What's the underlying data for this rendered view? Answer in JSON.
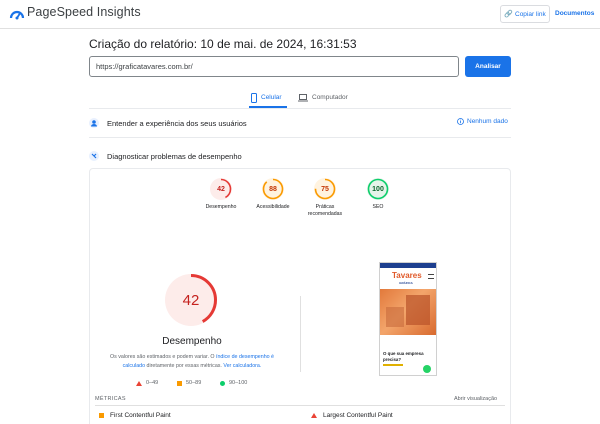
{
  "header": {
    "app_title": "PageSpeed Insights",
    "copy_link_label": "Copiar link",
    "docs_label": "Documentos"
  },
  "report": {
    "title": "Criação do relatório: 10 de mai. de 2024, 16:31:53",
    "url_value": "https://graficatavares.com.br/",
    "analyze_label": "Analisar"
  },
  "tabs": [
    {
      "label": "Celular",
      "selected": true
    },
    {
      "label": "Computador",
      "selected": false
    }
  ],
  "sections": {
    "experience_label": "Entender a experiência dos seus usuários",
    "no_data_label": "Nenhum dado",
    "diagnose_label": "Diagnosticar problemas de desempenho"
  },
  "scores": [
    {
      "label": "Desempenho",
      "value": 42,
      "color": "#e53935"
    },
    {
      "label": "Acessibilidade",
      "value": 88,
      "color": "#fa9a00"
    },
    {
      "label": "Práticas recomendadas",
      "value": 75,
      "color": "#fa9a00"
    },
    {
      "label": "SEO",
      "value": 100,
      "color": "#0cce6b"
    }
  ],
  "performance": {
    "score": "42",
    "title": "Desempenho",
    "desc_prefix": "Os valores são estimados e podem variar. O ",
    "desc_link1": "índice de desempenho é calculado",
    "desc_middle": " diretamente por essas métricas. ",
    "desc_link2": "Ver calculadora."
  },
  "legend": {
    "poor": "0–49",
    "average": "50–89",
    "good": "90–100"
  },
  "phone_preview": {
    "logo_text": "Tavares",
    "logo_sub": "GRÁFICA",
    "heading": "O que sua empresa precisa?"
  },
  "metrics": {
    "label": "MÉTRICAS",
    "expand_label": "Abrir visualização",
    "items": [
      {
        "label": "First Contentful Paint",
        "status": "average"
      },
      {
        "label": "Largest Contentful Paint",
        "status": "poor"
      }
    ]
  },
  "colors": {
    "accent": "#1a73e8",
    "poor": "#e53935",
    "average": "#fa9a00",
    "good": "#0cce6b"
  }
}
